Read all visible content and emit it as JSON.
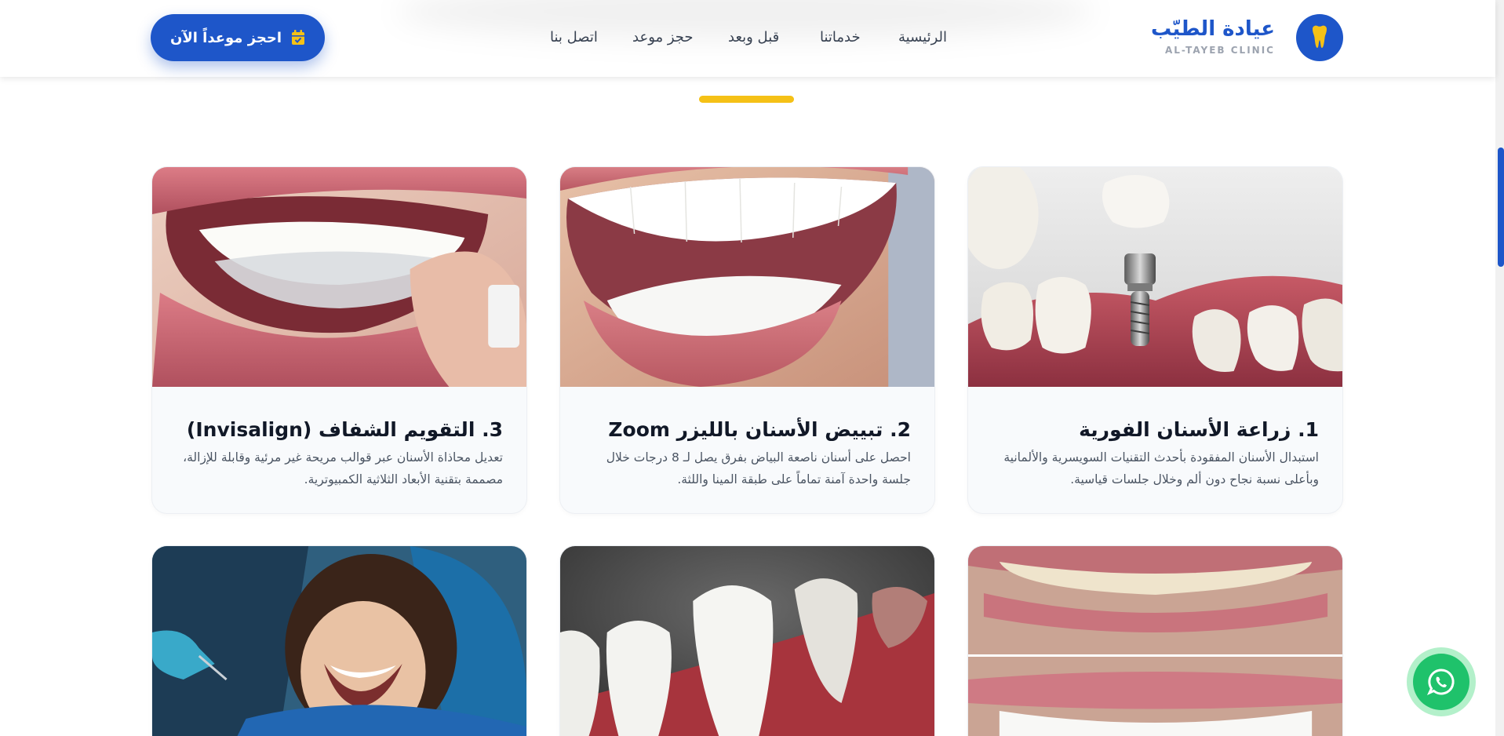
{
  "header": {
    "logo_title": "عيادة الطيّب",
    "logo_subtitle": "AL-TAYEB CLINIC",
    "nav": {
      "home": "الرئيسية",
      "services": "خدماتنا",
      "before_after": "قبل وبعد",
      "book": "حجز موعد",
      "contact": "اتصل بنا"
    },
    "cta_label": "احجز موعداً الآن"
  },
  "services": {
    "cards": [
      {
        "title": "1. زراعة الأسنان الفورية",
        "desc": "استبدال الأسنان المفقودة بأحدث التقنيات السويسرية والألمانية وبأعلى نسبة نجاح دون ألم وخلال جلسات قياسية."
      },
      {
        "title": "2. تبييض الأسنان بالليزر Zoom",
        "desc": "احصل على أسنان ناصعة البياض بفرق يصل لـ 8 درجات خلال جلسة واحدة آمنة تماماً على طبقة المينا واللثة."
      },
      {
        "title": "3. التقويم الشفاف (Invisalign)",
        "desc": "تعديل محاذاة الأسنان عبر قوالب مريحة غير مرئية وقابلة للإزالة، مصممة بتقنية الأبعاد الثلاثية الكمبيوترية."
      }
    ]
  },
  "colors": {
    "brand": "#1e56c9",
    "accent": "#f5c116",
    "whatsapp": "#1fc26b"
  },
  "icons": {
    "logo": "tooth-icon",
    "cta": "calendar-icon",
    "whatsapp": "whatsapp-icon"
  }
}
